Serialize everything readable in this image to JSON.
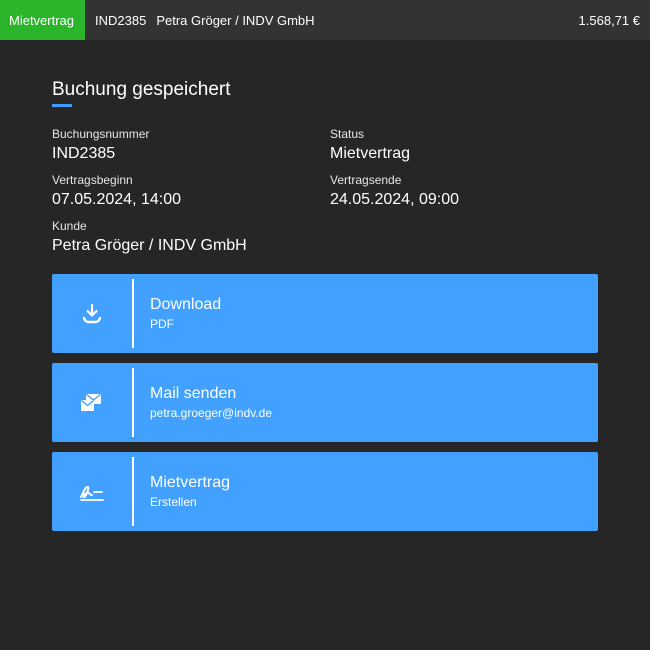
{
  "topbar": {
    "status": "Mietvertrag",
    "booking_number": "IND2385",
    "customer": "Petra Gröger / INDV GmbH",
    "amount": "1.568,71 €",
    "status_color": "#2bb52b"
  },
  "page": {
    "title": "Buchung gespeichert"
  },
  "info": {
    "booking_number_label": "Buchungsnummer",
    "booking_number_value": "IND2385",
    "status_label": "Status",
    "status_value": "Mietvertrag",
    "start_label": "Vertragsbeginn",
    "start_value": "07.05.2024, 14:00",
    "end_label": "Vertragsende",
    "end_value": "24.05.2024, 09:00",
    "customer_label": "Kunde",
    "customer_value": "Petra Gröger / INDV GmbH"
  },
  "actions": [
    {
      "title": "Download",
      "subtitle": "PDF",
      "icon": "download-icon"
    },
    {
      "title": "Mail senden",
      "subtitle": "petra.groeger@indv.de",
      "icon": "mail-send-icon"
    },
    {
      "title": "Mietvertrag",
      "subtitle": "Erstellen",
      "icon": "signature-icon"
    }
  ],
  "colors": {
    "accent": "#42a1ff",
    "background": "#262626",
    "topbar": "#333333"
  }
}
